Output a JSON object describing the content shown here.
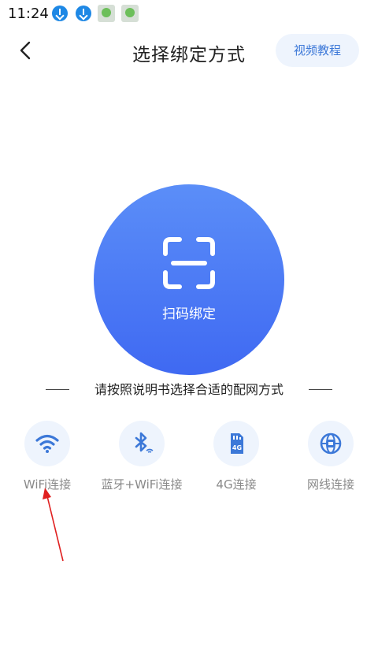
{
  "status_bar": {
    "time": "11:24",
    "icons": [
      "download-icon",
      "download-icon",
      "app-notification-icon",
      "app-notification-icon"
    ]
  },
  "header": {
    "back_icon": "chevron-left-icon",
    "title": "选择绑定方式",
    "video_button": "视频教程"
  },
  "scan": {
    "icon": "scan-frame-icon",
    "label": "扫码绑定",
    "color_top": "#5b8ef8",
    "color_bottom": "#3f69f2"
  },
  "instruction": "请按照说明书选择合适的配网方式",
  "options": [
    {
      "icon": "wifi-icon",
      "label": "WiFi连接"
    },
    {
      "icon": "bluetooth-wifi-icon",
      "label": "蓝牙+WiFi连接"
    },
    {
      "icon": "4g-sim-icon",
      "label": "4G连接"
    },
    {
      "icon": "ethernet-globe-icon",
      "label": "网线连接"
    }
  ],
  "colors": {
    "accent": "#3f69f2",
    "icon_blue": "#3c78d8",
    "annotation_arrow": "#e02020"
  }
}
